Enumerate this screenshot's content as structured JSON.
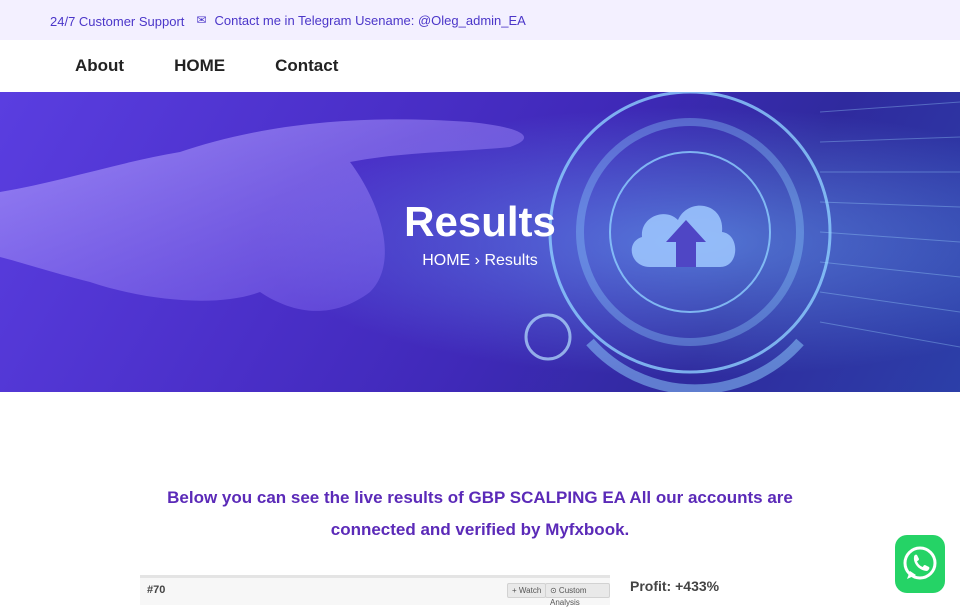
{
  "topbar": {
    "support_text": "24/7 Customer Support",
    "contact_text": "Contact me in Telegram Usename: @Oleg_admin_EA",
    "mail_icon": "envelope-icon"
  },
  "nav": {
    "items": [
      {
        "label": "About"
      },
      {
        "label": "HOME"
      },
      {
        "label": "Contact"
      }
    ]
  },
  "hero": {
    "title": "Results",
    "breadcrumb": {
      "home": "HOME",
      "separator": "›",
      "current": "Results"
    }
  },
  "intro": {
    "text_part1": "Below you can see the live results of GBP SCALPING EA All our accounts are connected and verified by ",
    "brand": "Myfxbook",
    "text_end": "."
  },
  "widget": {
    "number": "#70",
    "watch_label": "+ Watch",
    "analysis_label": "⊙ Custom Analysis"
  },
  "profit": {
    "text": "Profit: +433%"
  },
  "colors": {
    "accent": "#5b2ab8",
    "topbar_bg": "#f3f0ff",
    "hero_bg": "#4a2fc8",
    "whatsapp": "#25d366"
  }
}
